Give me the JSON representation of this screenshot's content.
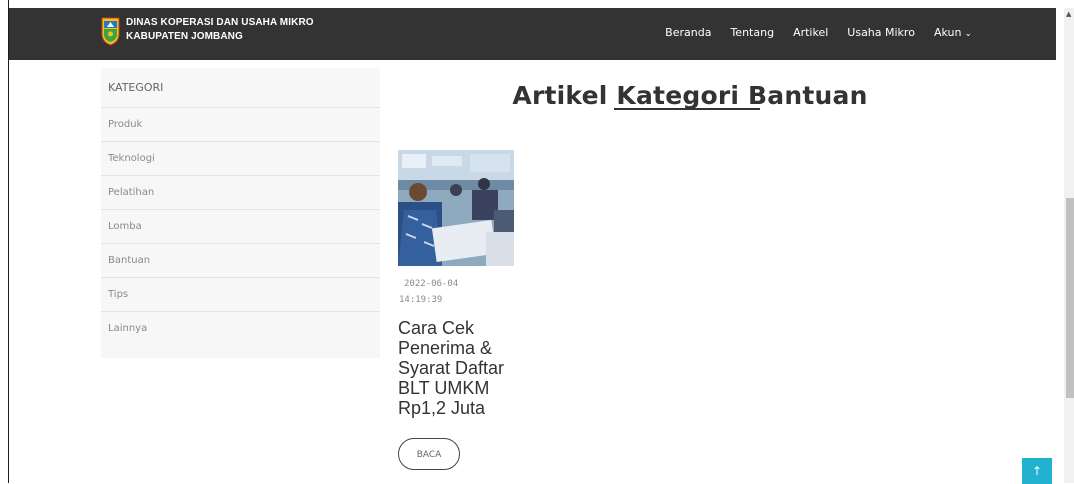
{
  "navbar": {
    "brand_line1": "DINAS KOPERASI DAN USAHA MIKRO",
    "brand_line2": "KABUPATEN JOMBANG",
    "logo_icon": "jombang-regency-crest",
    "menu": [
      {
        "label": "Beranda"
      },
      {
        "label": "Tentang"
      },
      {
        "label": "Artikel"
      },
      {
        "label": "Usaha Mikro"
      },
      {
        "label": "Akun"
      }
    ],
    "account_dropdown_icon": "chevron-down-icon",
    "background": "#333333"
  },
  "sidebar": {
    "title": "KATEGORI",
    "items": [
      {
        "label": "Produk"
      },
      {
        "label": "Teknologi"
      },
      {
        "label": "Pelatihan"
      },
      {
        "label": "Lomba"
      },
      {
        "label": "Bantuan"
      },
      {
        "label": "Tips"
      },
      {
        "label": "Lainnya"
      }
    ]
  },
  "main": {
    "title": "Artikel Kategori Bantuan",
    "articles": [
      {
        "date": "2022-06-04",
        "time": "14:19:39",
        "title": "Cara Cek Penerima & Syarat Daftar BLT UMKM Rp1,2 Juta",
        "read_label": "BACA"
      }
    ]
  },
  "back_to_top": {
    "icon": "arrow-up-icon",
    "color": "#22b2cf"
  }
}
